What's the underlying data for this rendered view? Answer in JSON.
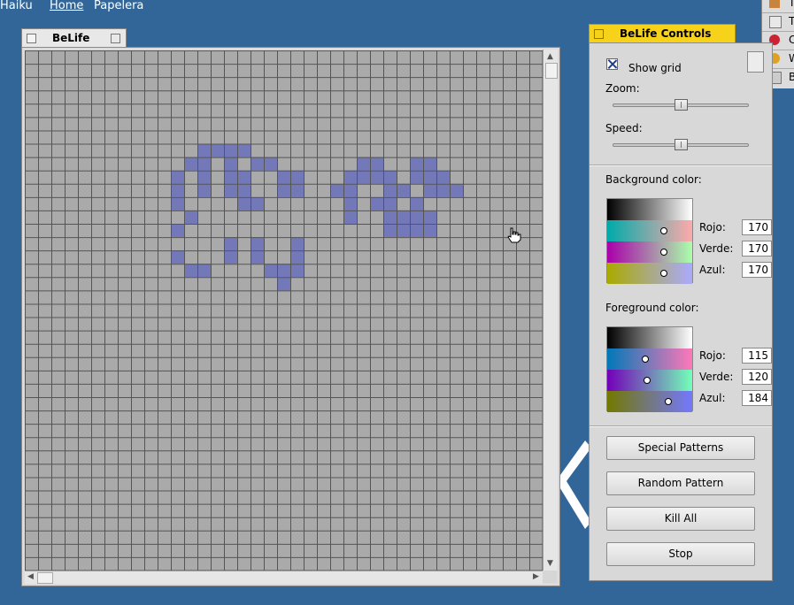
{
  "desktop": {
    "menu": [
      "Haiku",
      "Home",
      "Papelera"
    ],
    "tracker_items": [
      "T",
      "T",
      "C",
      "W",
      "B"
    ]
  },
  "life_window": {
    "title": "BeLife",
    "grid": {
      "cols": 39,
      "rows": 39,
      "cell_color": "#aaaaaa",
      "line_color": "#555555",
      "live_color": "#7378b8",
      "live_cells": [
        [
          13,
          7
        ],
        [
          14,
          7
        ],
        [
          15,
          7
        ],
        [
          16,
          7
        ],
        [
          12,
          8
        ],
        [
          13,
          8
        ],
        [
          15,
          8
        ],
        [
          17,
          8
        ],
        [
          18,
          8
        ],
        [
          25,
          8
        ],
        [
          26,
          8
        ],
        [
          29,
          8
        ],
        [
          30,
          8
        ],
        [
          11,
          9
        ],
        [
          13,
          9
        ],
        [
          15,
          9
        ],
        [
          16,
          9
        ],
        [
          19,
          9
        ],
        [
          20,
          9
        ],
        [
          24,
          9
        ],
        [
          25,
          9
        ],
        [
          26,
          9
        ],
        [
          27,
          9
        ],
        [
          29,
          9
        ],
        [
          30,
          9
        ],
        [
          31,
          9
        ],
        [
          11,
          10
        ],
        [
          13,
          10
        ],
        [
          15,
          10
        ],
        [
          16,
          10
        ],
        [
          19,
          10
        ],
        [
          20,
          10
        ],
        [
          23,
          10
        ],
        [
          24,
          10
        ],
        [
          27,
          10
        ],
        [
          28,
          10
        ],
        [
          30,
          10
        ],
        [
          31,
          10
        ],
        [
          32,
          10
        ],
        [
          11,
          11
        ],
        [
          16,
          11
        ],
        [
          17,
          11
        ],
        [
          24,
          11
        ],
        [
          26,
          11
        ],
        [
          27,
          11
        ],
        [
          29,
          11
        ],
        [
          12,
          12
        ],
        [
          24,
          12
        ],
        [
          27,
          12
        ],
        [
          28,
          12
        ],
        [
          29,
          12
        ],
        [
          30,
          12
        ],
        [
          11,
          13
        ],
        [
          27,
          13
        ],
        [
          28,
          13
        ],
        [
          29,
          13
        ],
        [
          30,
          13
        ],
        [
          15,
          14
        ],
        [
          17,
          14
        ],
        [
          20,
          14
        ],
        [
          11,
          15
        ],
        [
          15,
          15
        ],
        [
          17,
          15
        ],
        [
          20,
          15
        ],
        [
          12,
          16
        ],
        [
          13,
          16
        ],
        [
          18,
          16
        ],
        [
          19,
          16
        ],
        [
          20,
          16
        ],
        [
          19,
          17
        ]
      ]
    }
  },
  "controls": {
    "title": "BeLife Controls",
    "show_grid_label": "Show grid",
    "show_grid_checked": true,
    "zoom_label": "Zoom:",
    "zoom_value": 0.5,
    "speed_label": "Speed:",
    "speed_value": 0.5,
    "background": {
      "label": "Background color:",
      "rojo_label": "Rojo:",
      "verde_label": "Verde:",
      "azul_label": "Azul:",
      "rojo": "170",
      "verde": "170",
      "azul": "170"
    },
    "foreground": {
      "label": "Foreground color:",
      "rojo_label": "Rojo:",
      "verde_label": "Verde:",
      "azul_label": "Azul:",
      "rojo": "115",
      "verde": "120",
      "azul": "184"
    },
    "buttons": {
      "special_patterns": "Special Patterns",
      "random_pattern": "Random Pattern",
      "kill_all": "Kill All",
      "stop": "Stop"
    }
  }
}
